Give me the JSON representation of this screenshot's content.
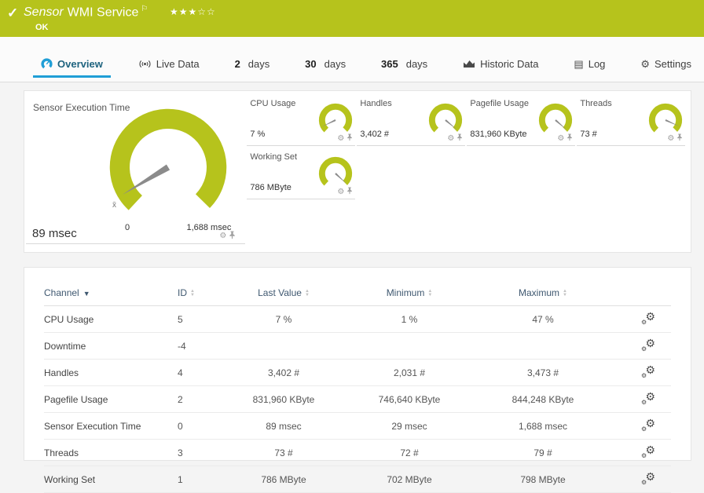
{
  "header": {
    "title_prefix": "Sensor",
    "title": "WMI Service",
    "status": "OK",
    "stars": "★★★☆☆"
  },
  "tabs": [
    {
      "label": "Overview"
    },
    {
      "label": "Live Data"
    },
    {
      "num": "2",
      "label": "days"
    },
    {
      "num": "30",
      "label": "days"
    },
    {
      "num": "365",
      "label": "days"
    },
    {
      "label": "Historic Data"
    },
    {
      "label": "Log"
    },
    {
      "label": "Settings"
    }
  ],
  "main_gauge": {
    "title": "Sensor Execution Time",
    "value": "89 msec",
    "scale_min": "0",
    "scale_max": "1,688 msec",
    "avg_marker": "x̄"
  },
  "mini_gauges": [
    {
      "title": "CPU Usage",
      "value": "7 %"
    },
    {
      "title": "Handles",
      "value": "3,402 #"
    },
    {
      "title": "Pagefile Usage",
      "value": "831,960 KByte"
    },
    {
      "title": "Threads",
      "value": "73 #"
    },
    {
      "title": "Working Set",
      "value": "786 MByte"
    }
  ],
  "table": {
    "columns": [
      "Channel",
      "ID",
      "Last Value",
      "Minimum",
      "Maximum"
    ],
    "rows": [
      {
        "channel": "CPU Usage",
        "id": "5",
        "last": "7 %",
        "min": "1 %",
        "max": "47 %"
      },
      {
        "channel": "Downtime",
        "id": "-4",
        "last": "",
        "min": "",
        "max": ""
      },
      {
        "channel": "Handles",
        "id": "4",
        "last": "3,402 #",
        "min": "2,031 #",
        "max": "3,473 #"
      },
      {
        "channel": "Pagefile Usage",
        "id": "2",
        "last": "831,960 KByte",
        "min": "746,640 KByte",
        "max": "844,248 KByte"
      },
      {
        "channel": "Sensor Execution Time",
        "id": "0",
        "last": "89 msec",
        "min": "29 msec",
        "max": "1,688 msec"
      },
      {
        "channel": "Threads",
        "id": "3",
        "last": "73 #",
        "min": "72 #",
        "max": "79 #"
      },
      {
        "channel": "Working Set",
        "id": "1",
        "last": "786 MByte",
        "min": "702 MByte",
        "max": "798 MByte"
      }
    ]
  },
  "colors": {
    "header_green": "#b6c31c",
    "gauge_green": "#b6c31c",
    "needle_gray": "#8b8b8b",
    "accent_blue": "#1f9ed6"
  }
}
